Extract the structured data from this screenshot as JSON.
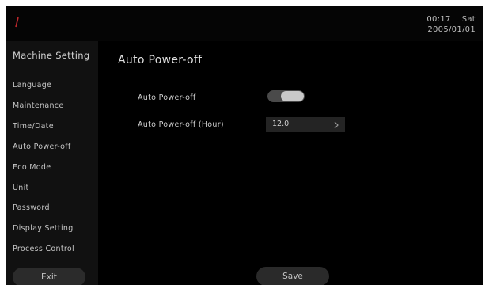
{
  "clock": {
    "time": "00:17",
    "day": "Sat",
    "date": "2005/01/01"
  },
  "brand": {
    "icon": "brand-logo-mark",
    "color": "#c0282d"
  },
  "sidebar": {
    "title": "Machine Setting",
    "items": [
      {
        "label": "Language"
      },
      {
        "label": "Maintenance"
      },
      {
        "label": "Time/Date"
      },
      {
        "label": "Auto Power-off"
      },
      {
        "label": "Eco Mode"
      },
      {
        "label": "Unit"
      },
      {
        "label": "Password"
      },
      {
        "label": "Display Setting"
      },
      {
        "label": "Process Control"
      }
    ],
    "exit_label": "Exit"
  },
  "main": {
    "title": "Auto Power-off",
    "settings": {
      "auto_power_off": {
        "label": "Auto Power-off",
        "enabled": true
      },
      "auto_power_off_hour": {
        "label": "Auto Power-off (Hour)",
        "value": "12.0",
        "icon": "chevron-right-icon"
      }
    },
    "save_label": "Save"
  }
}
